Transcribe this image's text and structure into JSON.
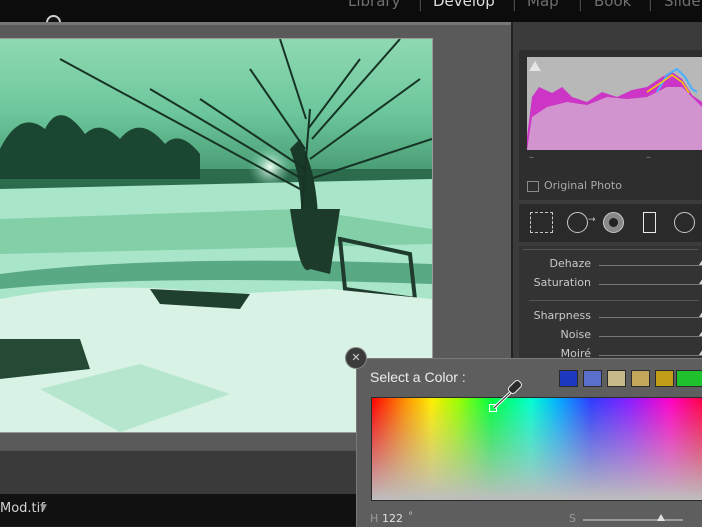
{
  "top_nav": {
    "items": [
      "Library",
      "Develop",
      "Map",
      "Book",
      "Slide"
    ],
    "active": "Develop"
  },
  "filmstrip": {
    "filename": "Mod.tif"
  },
  "histogram": {
    "original_photo_label": "Original Photo"
  },
  "develop_sliders": [
    {
      "label": "Dehaze",
      "value_fraction": 1.0
    },
    {
      "label": "Saturation",
      "value_fraction": 1.0
    },
    {
      "label": "Sharpness",
      "value_fraction": 1.0
    },
    {
      "label": "Noise",
      "value_fraction": 1.0
    },
    {
      "label": "Moiré",
      "value_fraction": 1.0
    }
  ],
  "color_picker": {
    "title": "Select a Color :",
    "swatches": [
      "#1d39c2",
      "#5a6fc9",
      "#c8b98a",
      "#c2a65b",
      "#c29d17"
    ],
    "selected_swatch": "#1fc22c",
    "hue_label": "H",
    "hue_value": "122",
    "hue_unit": "°",
    "saturation_label": "S",
    "saturation_fraction": 0.78
  },
  "icons": {
    "close": "close-icon",
    "eyedropper": "eyedropper-icon",
    "crop": "crop-icon",
    "spot_removal": "spot-removal-icon",
    "red_eye": "red-eye-icon",
    "graduated_filter": "graduated-filter-icon",
    "radial_filter": "radial-filter-icon",
    "clipping_warning": "clipping-warning-icon"
  }
}
